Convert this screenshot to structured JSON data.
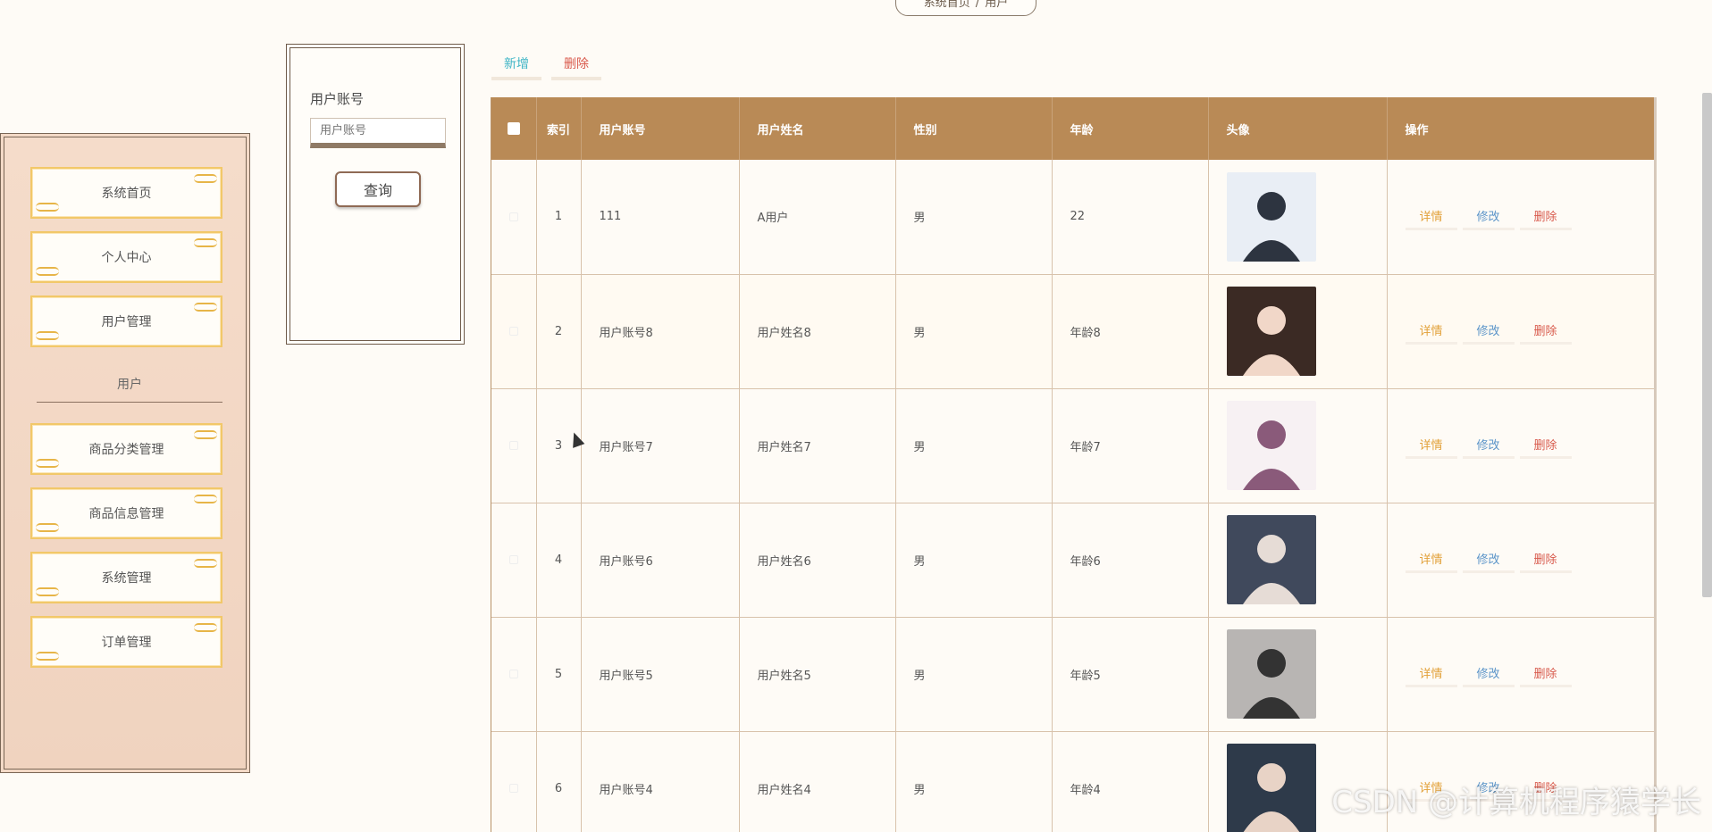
{
  "breadcrumb": {
    "home": "系统首页",
    "sep": "/",
    "current": "用户"
  },
  "sidebar": {
    "items_top": [
      "系统首页",
      "个人中心",
      "用户管理"
    ],
    "group_label": "用户",
    "items_bottom": [
      "商品分类管理",
      "商品信息管理",
      "系统管理",
      "订单管理"
    ]
  },
  "search": {
    "label": "用户账号",
    "placeholder": "用户账号",
    "button": "查询"
  },
  "toolbar": {
    "add": "新增",
    "delete": "删除"
  },
  "table": {
    "headers": {
      "index": "索引",
      "account": "用户账号",
      "name": "用户姓名",
      "gender": "性别",
      "age": "年龄",
      "avatar": "头像",
      "actions": "操作"
    },
    "rows": [
      {
        "index": "1",
        "account": "111",
        "name": "A用户",
        "gender": "男",
        "age": "22"
      },
      {
        "index": "2",
        "account": "用户账号8",
        "name": "用户姓名8",
        "gender": "男",
        "age": "年龄8"
      },
      {
        "index": "3",
        "account": "用户账号7",
        "name": "用户姓名7",
        "gender": "男",
        "age": "年龄7"
      },
      {
        "index": "4",
        "account": "用户账号6",
        "name": "用户姓名6",
        "gender": "男",
        "age": "年龄6"
      },
      {
        "index": "5",
        "account": "用户账号5",
        "name": "用户姓名5",
        "gender": "男",
        "age": "年龄5"
      },
      {
        "index": "6",
        "account": "用户账号4",
        "name": "用户姓名4",
        "gender": "男",
        "age": "年龄4"
      }
    ],
    "actions": {
      "detail": "详情",
      "edit": "修改",
      "delete": "删除"
    }
  },
  "watermark": "CSDN @计算机程序猿学长",
  "colors": {
    "header_bg": "#b98a56",
    "add": "#3fb5c6",
    "delete": "#d9594c",
    "detail": "#e2a13a",
    "edit": "#5c95c9"
  }
}
